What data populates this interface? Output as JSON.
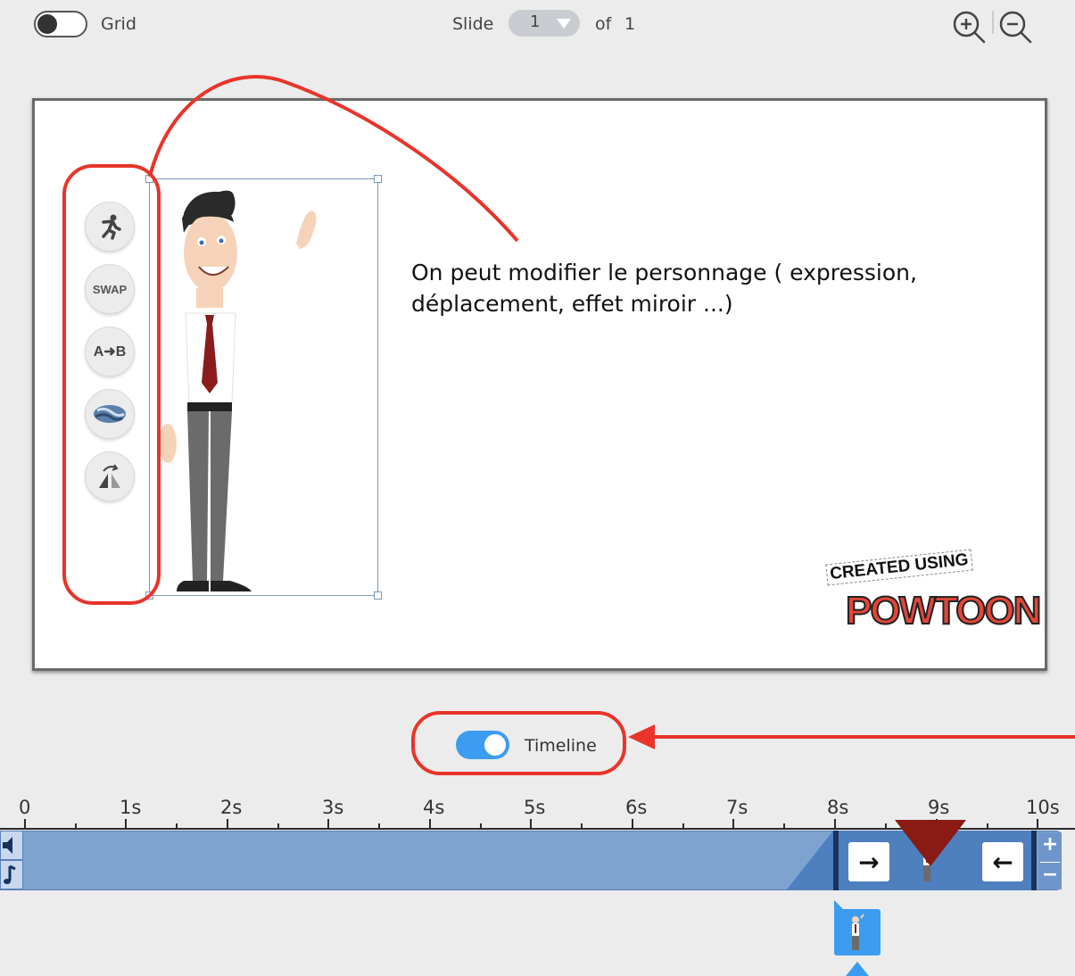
{
  "toolbar": {
    "grid_label": "Grid",
    "grid_enabled": false,
    "slide_label": "Slide",
    "slide_value": "1",
    "of_label": "of",
    "total_slides": "1",
    "zoom_in_icon": "zoom-in-icon",
    "zoom_out_icon": "zoom-out-icon"
  },
  "canvas": {
    "annotation": "On peut modifier le personnage ( expression, déplacement, effet miroir ...)",
    "tools": [
      {
        "icon": "action-icon",
        "label": ""
      },
      {
        "icon": "swap-icon",
        "label": "SWAP"
      },
      {
        "icon": "a-to-b-icon",
        "label": "A➜B"
      },
      {
        "icon": "color-icon",
        "label": ""
      },
      {
        "icon": "flip-icon",
        "label": ""
      }
    ],
    "watermark_line1": "CREATED USING",
    "watermark_line2": "POWTOON"
  },
  "timeline": {
    "toggle_label": "Timeline",
    "enabled": true,
    "ticks": [
      "0",
      "1s",
      "2s",
      "3s",
      "4s",
      "5s",
      "6s",
      "7s",
      "8s",
      "9s",
      "10s"
    ],
    "clip_enter_icon": "→",
    "clip_exit_icon": "←",
    "plus": "+",
    "minus": "−"
  },
  "colors": {
    "accent": "#3c9cf0",
    "annotation_red": "#e8342a",
    "track": "#7fa3d1",
    "clip": "#4e7fbe",
    "playhead": "#8a1a14"
  }
}
